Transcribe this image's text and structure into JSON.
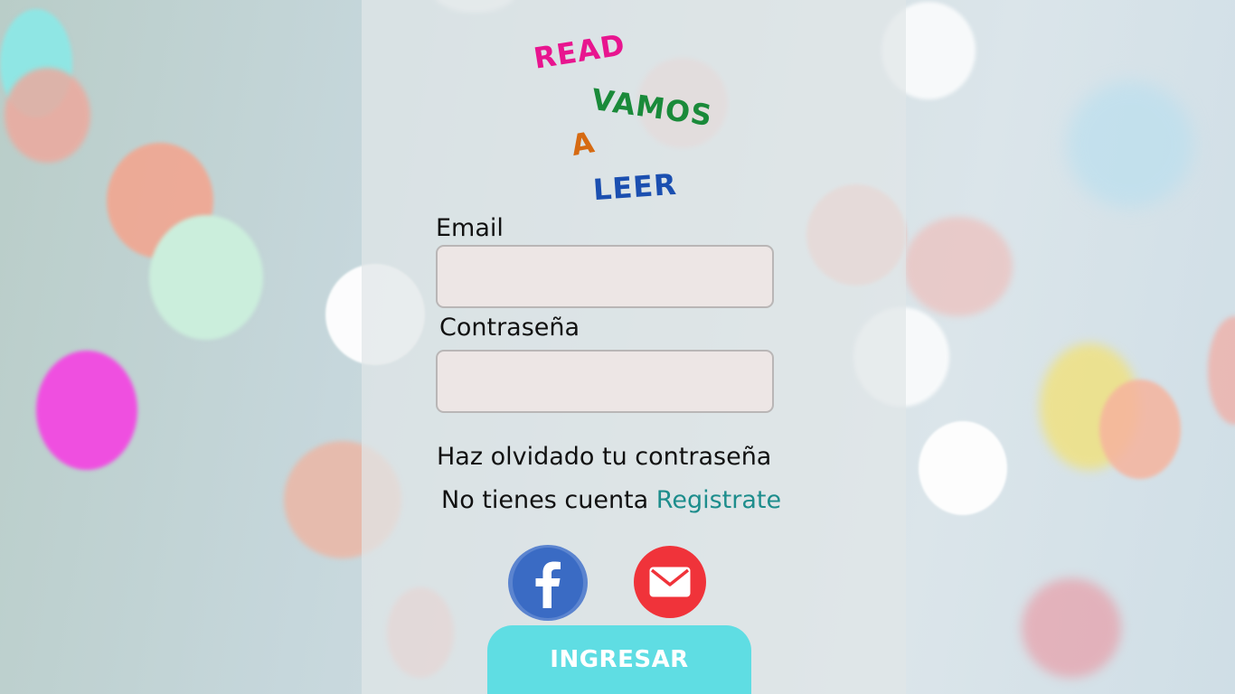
{
  "logo": {
    "word1": "READ",
    "word2": "VAMOS",
    "word3": "A",
    "word4": "LEER",
    "colors": {
      "word1": "#e8158f",
      "word2": "#1a8a3a",
      "word3": "#d66a12",
      "word4": "#1b4fb0"
    }
  },
  "form": {
    "email_label": "Email",
    "email_value": "",
    "password_label": "Contraseña",
    "password_value": ""
  },
  "links": {
    "forgot_password": "Haz olvidado tu contraseña",
    "no_account": "No tienes cuenta",
    "register": "Registrate"
  },
  "social": {
    "facebook_icon": "facebook-icon",
    "mail_icon": "mail-icon",
    "facebook_color": "#3a6bc4",
    "mail_color": "#f0333a"
  },
  "submit": {
    "label": "INGRESAR",
    "color": "#5fdde3"
  },
  "colors": {
    "link_accent": "#1d8d8c"
  }
}
